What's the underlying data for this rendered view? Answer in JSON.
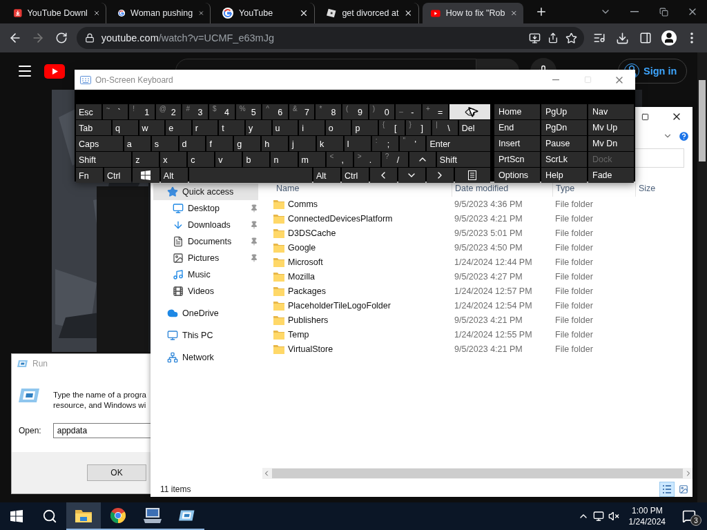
{
  "browser": {
    "tabs": [
      {
        "title": "YouTube Downl",
        "kind": "download",
        "selected": false
      },
      {
        "title": "Woman pushing",
        "kind": "google",
        "selected": false
      },
      {
        "title": "YouTube",
        "kind": "google",
        "selected": false
      },
      {
        "title": "get divorced at",
        "kind": "tile",
        "selected": false
      },
      {
        "title": "How to fix \"Rob",
        "kind": "video",
        "selected": true
      }
    ],
    "address": {
      "host": "youtube.com",
      "path": "/watch?v=UCMF_e63mJg"
    }
  },
  "youtube": {
    "sign_in": "Sign in"
  },
  "keyboard": {
    "title": "On-Screen Keyboard",
    "rows": [
      {
        "keys": [
          {
            "kind": "text",
            "label": "Esc",
            "highlighted": false
          },
          {
            "kind": "char",
            "shift": "~",
            "label": "`",
            "highlighted": false
          },
          {
            "kind": "char",
            "shift": "!",
            "label": "1",
            "highlighted": false
          },
          {
            "kind": "char",
            "shift": "@",
            "label": "2",
            "highlighted": false
          },
          {
            "kind": "char",
            "shift": "#",
            "label": "3",
            "highlighted": false
          },
          {
            "kind": "char",
            "shift": "$",
            "label": "4",
            "highlighted": false
          },
          {
            "kind": "char",
            "shift": "%",
            "label": "5",
            "highlighted": false
          },
          {
            "kind": "char",
            "shift": "^",
            "label": "6",
            "highlighted": false
          },
          {
            "kind": "char",
            "shift": "&",
            "label": "7",
            "highlighted": false
          },
          {
            "kind": "char",
            "shift": "*",
            "label": "8",
            "highlighted": false
          },
          {
            "kind": "char",
            "shift": "(",
            "label": "9",
            "highlighted": false
          },
          {
            "kind": "char",
            "shift": ")",
            "label": "0",
            "highlighted": false
          },
          {
            "kind": "char",
            "shift": "_",
            "label": "-",
            "highlighted": false
          },
          {
            "kind": "char",
            "shift": "+",
            "label": "=",
            "highlighted": false
          },
          {
            "kind": "backspace",
            "highlighted": true
          }
        ]
      },
      {
        "keys": [
          {
            "kind": "text",
            "label": "Tab",
            "highlighted": false
          },
          {
            "kind": "char",
            "label": "q",
            "highlighted": false
          },
          {
            "kind": "char",
            "label": "w",
            "highlighted": false
          },
          {
            "kind": "char",
            "label": "e",
            "highlighted": false
          },
          {
            "kind": "char",
            "label": "r",
            "highlighted": false
          },
          {
            "kind": "char",
            "label": "t",
            "highlighted": false
          },
          {
            "kind": "char",
            "label": "y",
            "highlighted": false
          },
          {
            "kind": "char",
            "label": "u",
            "highlighted": false
          },
          {
            "kind": "char",
            "label": "i",
            "highlighted": false
          },
          {
            "kind": "char",
            "label": "o",
            "highlighted": false
          },
          {
            "kind": "char",
            "label": "p",
            "highlighted": false
          },
          {
            "kind": "char",
            "shift": "{",
            "label": "[",
            "highlighted": false
          },
          {
            "kind": "char",
            "shift": "}",
            "label": "]",
            "highlighted": false
          },
          {
            "kind": "char",
            "shift": "|",
            "label": "\\",
            "highlighted": false
          },
          {
            "kind": "text",
            "label": "Del",
            "highlighted": false
          }
        ]
      },
      {
        "keys": [
          {
            "kind": "text",
            "label": "Caps",
            "highlighted": false
          },
          {
            "kind": "char",
            "label": "a",
            "highlighted": false
          },
          {
            "kind": "char",
            "label": "s",
            "highlighted": false
          },
          {
            "kind": "char",
            "label": "d",
            "highlighted": false
          },
          {
            "kind": "char",
            "label": "f",
            "highlighted": false
          },
          {
            "kind": "char",
            "label": "g",
            "highlighted": false
          },
          {
            "kind": "char",
            "label": "h",
            "highlighted": false
          },
          {
            "kind": "char",
            "label": "j",
            "highlighted": false
          },
          {
            "kind": "char",
            "label": "k",
            "highlighted": false
          },
          {
            "kind": "char",
            "label": "l",
            "highlighted": false
          },
          {
            "kind": "char",
            "shift": ":",
            "label": ";",
            "highlighted": false
          },
          {
            "kind": "char",
            "shift": "\"",
            "label": "'",
            "highlighted": false
          },
          {
            "kind": "text",
            "label": "Enter",
            "highlighted": false
          }
        ]
      },
      {
        "keys": [
          {
            "kind": "text",
            "label": "Shift",
            "highlighted": false
          },
          {
            "kind": "char",
            "label": "z",
            "highlighted": false
          },
          {
            "kind": "char",
            "label": "x",
            "highlighted": false
          },
          {
            "kind": "char",
            "label": "c",
            "highlighted": false
          },
          {
            "kind": "char",
            "label": "v",
            "highlighted": false
          },
          {
            "kind": "char",
            "label": "b",
            "highlighted": false
          },
          {
            "kind": "char",
            "label": "n",
            "highlighted": false
          },
          {
            "kind": "char",
            "label": "m",
            "highlighted": false
          },
          {
            "kind": "char",
            "shift": "<",
            "label": ",",
            "highlighted": false
          },
          {
            "kind": "char",
            "shift": ">",
            "label": ".",
            "highlighted": false
          },
          {
            "kind": "char",
            "shift": "?",
            "label": "/",
            "highlighted": false
          },
          {
            "kind": "up",
            "highlighted": false
          },
          {
            "kind": "text",
            "label": "Shift",
            "highlighted": false
          }
        ]
      },
      {
        "keys": [
          {
            "kind": "text",
            "label": "Fn",
            "highlighted": false
          },
          {
            "kind": "text",
            "label": "Ctrl",
            "highlighted": false
          },
          {
            "kind": "windows",
            "highlighted": false
          },
          {
            "kind": "text",
            "label": "Alt",
            "highlighted": false
          },
          {
            "kind": "space",
            "highlighted": false
          },
          {
            "kind": "text",
            "label": "Alt",
            "highlighted": false
          },
          {
            "kind": "text",
            "label": "Ctrl",
            "highlighted": false
          },
          {
            "kind": "left",
            "highlighted": false
          },
          {
            "kind": "down",
            "highlighted": false
          },
          {
            "kind": "right",
            "highlighted": false
          },
          {
            "kind": "menu",
            "highlighted": false
          }
        ]
      }
    ],
    "nav": [
      {
        "label": "Home",
        "disabled": false
      },
      {
        "label": "PgUp",
        "disabled": false
      },
      {
        "label": "Nav",
        "disabled": false
      },
      {
        "label": "End",
        "disabled": false
      },
      {
        "label": "PgDn",
        "disabled": false
      },
      {
        "label": "Mv Up",
        "disabled": false
      },
      {
        "label": "Insert",
        "disabled": false
      },
      {
        "label": "Pause",
        "disabled": false
      },
      {
        "label": "Mv Dn",
        "disabled": false
      },
      {
        "label": "PrtScn",
        "disabled": false
      },
      {
        "label": "ScrLk",
        "disabled": false
      },
      {
        "label": "Dock",
        "disabled": true
      },
      {
        "label": "Options",
        "disabled": false
      },
      {
        "label": "Help",
        "disabled": false
      },
      {
        "label": "Fade",
        "disabled": false
      }
    ]
  },
  "explorer": {
    "nav": [
      {
        "label": "Quick access",
        "kind": "star",
        "selected": true,
        "children": [
          {
            "label": "Desktop",
            "kind": "desktop",
            "pinned": true,
            "selected": false
          },
          {
            "label": "Downloads",
            "kind": "download",
            "pinned": true,
            "selected": false
          },
          {
            "label": "Documents",
            "kind": "document",
            "pinned": true,
            "selected": false
          },
          {
            "label": "Pictures",
            "kind": "picture",
            "pinned": true,
            "selected": false
          },
          {
            "label": "Music",
            "kind": "music",
            "pinned": false,
            "selected": false
          },
          {
            "label": "Videos",
            "kind": "video",
            "pinned": false,
            "selected": false
          }
        ]
      },
      {
        "label": "OneDrive",
        "kind": "cloud",
        "selected": false
      },
      {
        "label": "This PC",
        "kind": "pc",
        "selected": false
      },
      {
        "label": "Network",
        "kind": "network",
        "selected": false
      }
    ],
    "columns": [
      "Name",
      "Date modified",
      "Type",
      "Size"
    ],
    "rows": [
      {
        "name": "Comms",
        "date": "9/5/2023 4:36 PM",
        "type": "File folder"
      },
      {
        "name": "ConnectedDevicesPlatform",
        "date": "9/5/2023 4:21 PM",
        "type": "File folder"
      },
      {
        "name": "D3DSCache",
        "date": "9/5/2023 5:01 PM",
        "type": "File folder"
      },
      {
        "name": "Google",
        "date": "9/5/2023 4:50 PM",
        "type": "File folder"
      },
      {
        "name": "Microsoft",
        "date": "1/24/2024 12:44 PM",
        "type": "File folder"
      },
      {
        "name": "Mozilla",
        "date": "9/5/2023 4:27 PM",
        "type": "File folder"
      },
      {
        "name": "Packages",
        "date": "1/24/2024 12:57 PM",
        "type": "File folder"
      },
      {
        "name": "PlaceholderTileLogoFolder",
        "date": "1/24/2024 12:54 PM",
        "type": "File folder"
      },
      {
        "name": "Publishers",
        "date": "9/5/2023 4:21 PM",
        "type": "File folder"
      },
      {
        "name": "Temp",
        "date": "1/24/2024 12:55 PM",
        "type": "File folder"
      },
      {
        "name": "VirtualStore",
        "date": "9/5/2023 4:21 PM",
        "type": "File folder"
      }
    ],
    "status": "11 items",
    "views": [
      {
        "kind": "details",
        "selected": true
      },
      {
        "kind": "tiles",
        "selected": false
      }
    ]
  },
  "run": {
    "title": "Run",
    "message_lines": [
      "Type the name of a progra",
      "resource, and Windows wi"
    ],
    "open_label": "Open:",
    "value": "appdata",
    "ok": "OK"
  },
  "taskbar": {
    "apps": [
      {
        "kind": "explorer",
        "selected": true
      },
      {
        "kind": "chrome",
        "selected": false
      },
      {
        "kind": "keyboard",
        "selected": false
      },
      {
        "kind": "run",
        "selected": false
      }
    ],
    "time": "1:00 PM",
    "date": "1/24/2024",
    "notifications": "3"
  }
}
